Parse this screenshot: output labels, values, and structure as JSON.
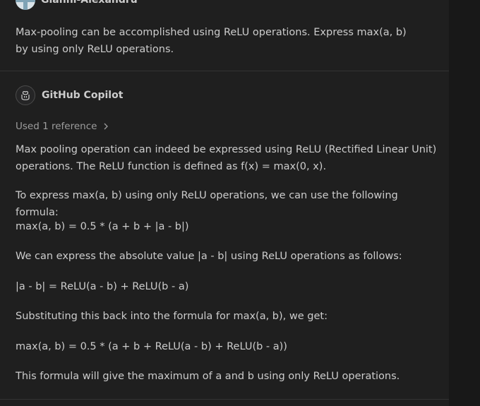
{
  "user": {
    "name": "Gianni-Alexandru",
    "message": "Max-pooling can be accomplished using ReLU operations. Express max(a, b) by using only ReLU operations."
  },
  "copilot": {
    "name": "GitHub Copilot",
    "references_label": "Used 1 reference",
    "paragraphs": [
      "Max pooling operation can indeed be expressed using ReLU (Rectified Linear Unit) operations. The ReLU function is defined as f(x) = max(0, x).",
      "To express max(a, b) using only ReLU operations, we can use the following formula:",
      "max(a, b) = 0.5 * (a + b + |a - b|)",
      "We can express the absolute value |a - b| using ReLU operations as follows:",
      "|a - b| = ReLU(a - b) + ReLU(b - a)",
      "Substituting this back into the formula for max(a, b), we get:",
      "max(a, b) = 0.5 * (a + b + ReLU(a - b) + ReLU(b - a))",
      "This formula will give the maximum of a and b using only ReLU operations."
    ]
  },
  "icons": {
    "user_avatar": "avatar-icon",
    "copilot_avatar": "copilot-icon",
    "reference_toggle": "chevron-right-icon"
  },
  "colors": {
    "background": "#1f1f1f",
    "sidebar": "#181818",
    "text": "#cccccc",
    "muted_text": "#9d9d9d",
    "divider": "#333333"
  }
}
